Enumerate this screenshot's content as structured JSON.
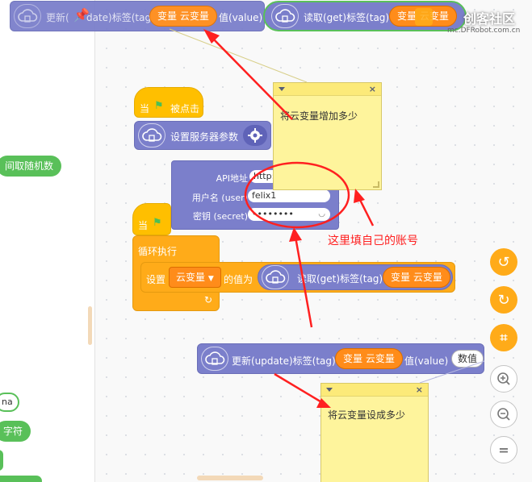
{
  "palette": {
    "items": [
      {
        "label": "间取随机数"
      },
      {
        "label": "na"
      },
      {
        "label": "字符"
      }
    ]
  },
  "top_block": {
    "update_prefix": "更新(",
    "update_suffix": "date)标签(tag)",
    "var_pill": "变量 云变量",
    "value_label": "值(value)",
    "get_label": "读取(get)标签(tag)",
    "get_var_pill": "变量 云变量"
  },
  "watermark": {
    "brand": "创客社区",
    "url": "mc.DFRobot.com.cn"
  },
  "hat1": {
    "label_when": "当",
    "label_clicked": "被点击"
  },
  "server_block": {
    "label": "设置服务器参数"
  },
  "settings_popup": {
    "api_label": "API地址",
    "api_value": "http://tinywebdb.",
    "user_label": "用户名 (user)",
    "user_value": "felix1",
    "secret_label": "密钥 (secret)",
    "secret_value": "••••••••"
  },
  "hat2": {
    "label_when": "当"
  },
  "forever_block": {
    "label": "循环执行"
  },
  "set_block": {
    "label": "设置",
    "var_dropdown": "云变量",
    "value_label": "的值为",
    "get_label": "读取(get)标签(tag)",
    "get_var_pill": "变量 云变量"
  },
  "update_block": {
    "label": "更新(update)标签(tag)",
    "var_pill": "变量 云变量",
    "value_label": "值(value)",
    "value_input": "数值"
  },
  "note1": {
    "text": "将云变量增加多少"
  },
  "note2": {
    "text": "将云变量设成多少"
  },
  "annotation": {
    "text": "这里填自己的账号",
    "color": "#ff1f1f"
  },
  "colors": {
    "cloud_block": "#7b7fcb",
    "variable_pill": "#ff8c1a",
    "control": "#ffab19",
    "event": "#ffbf00",
    "note": "#fef49c",
    "palette_green": "#59c059"
  }
}
